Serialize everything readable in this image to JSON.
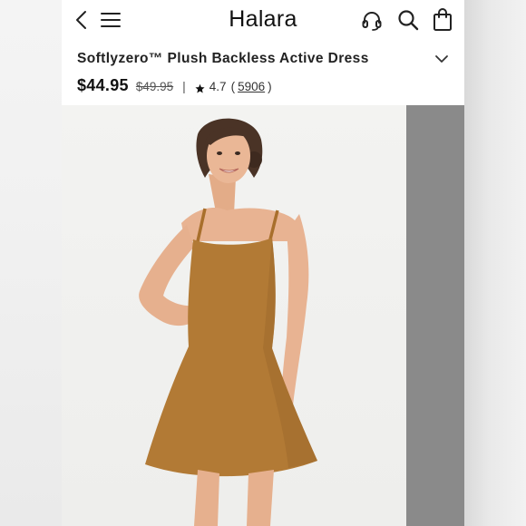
{
  "header": {
    "brand": "Halara",
    "icons": [
      "back-icon",
      "menu-icon",
      "headset-icon",
      "search-icon",
      "bag-icon"
    ]
  },
  "product": {
    "title": "Softlyzero™ Plush Backless Active Dress",
    "price": "$44.95",
    "original_price": "$49.95",
    "divider": "|",
    "rating": "4.7",
    "open_paren": "(",
    "review_count": "5906",
    "close_paren": ")"
  },
  "gallery": {
    "image": "model wearing brown backless active dress",
    "dress_color": "#b27a35"
  }
}
